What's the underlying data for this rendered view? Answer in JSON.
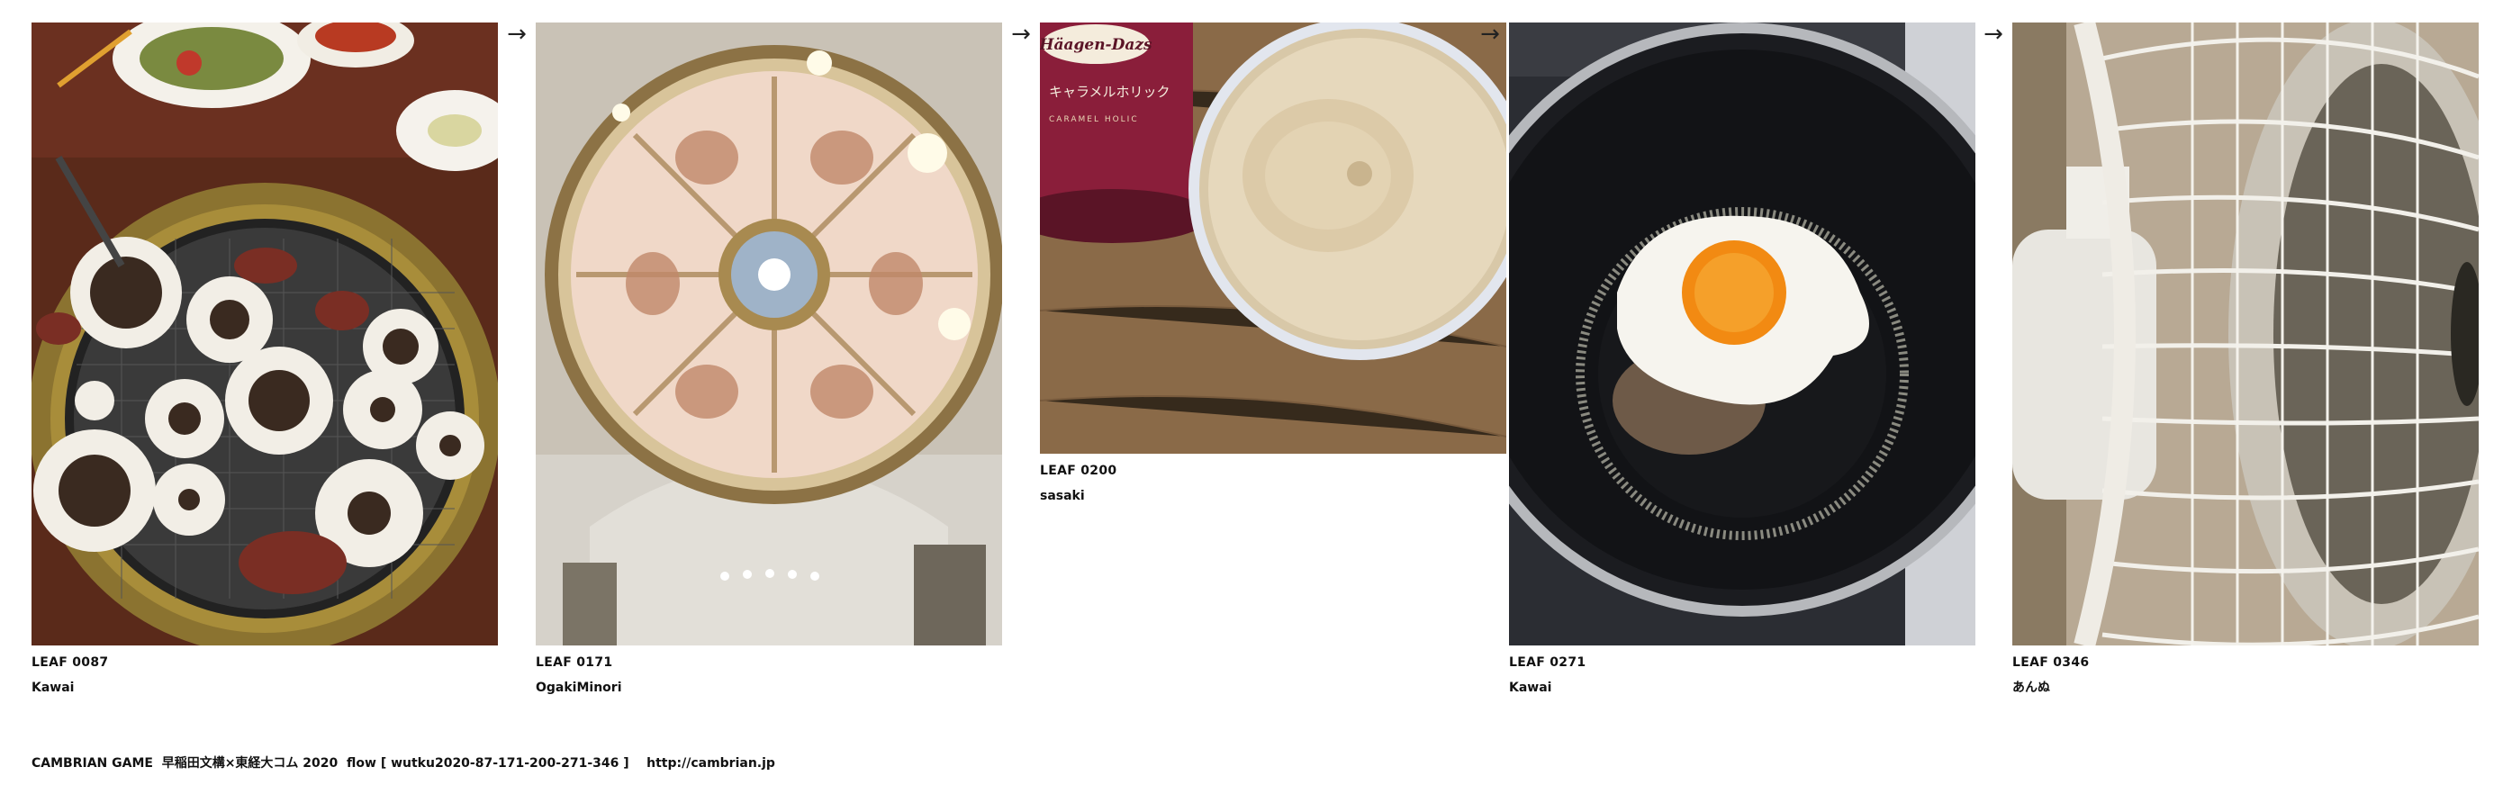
{
  "flow": {
    "cards": [
      {
        "leaf": "LEAF 0087",
        "author": "Kawai",
        "image": "yakiniku-grill-photo"
      },
      {
        "leaf": "LEAF 0171",
        "author": "OgakiMinori",
        "image": "cathedral-dome-photo"
      },
      {
        "leaf": "LEAF 0200",
        "author": "sasaki",
        "image": "haagen-dazs-ice-cream-photo",
        "brand_text": "Häagen-Dazs",
        "label_text": "キャラメルホリック",
        "sub_label_text": "CARAMEL HOLIC"
      },
      {
        "leaf": "LEAF 0271",
        "author": "Kawai",
        "image": "fried-egg-pan-photo"
      },
      {
        "leaf": "LEAF 0346",
        "author": "あんぬ",
        "image": "electric-fan-photo"
      }
    ],
    "arrow_glyph": "→"
  },
  "footer": {
    "text": "CAMBRIAN GAME  早稲田文構×東経大コム 2020  flow [ wutku2020-87-171-200-271-346 ]    http://cambrian.jp"
  },
  "colors": {
    "background": "#ffffff",
    "text": "#111111"
  }
}
